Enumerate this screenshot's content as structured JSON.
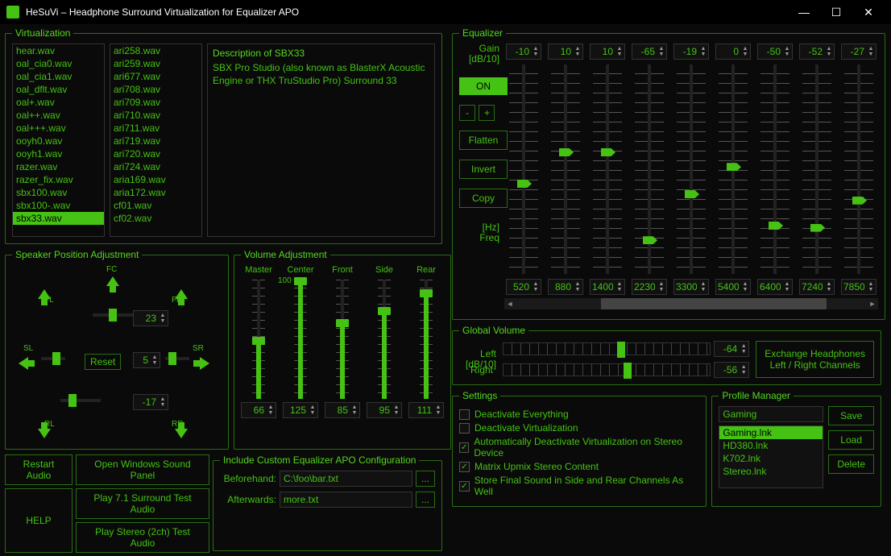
{
  "window": {
    "title": "HeSuVi – Headphone Surround Virtualization for Equalizer APO",
    "min": "—",
    "max": "☐",
    "close": "✕"
  },
  "virtualization": {
    "legend": "Virtualization",
    "list1": [
      "hear.wav",
      "oal_cia0.wav",
      "oal_cia1.wav",
      "oal_dflt.wav",
      "oal+.wav",
      "oal++.wav",
      "oal+++.wav",
      "ooyh0.wav",
      "ooyh1.wav",
      "razer.wav",
      "razer_fix.wav",
      "sbx100.wav",
      "sbx100-.wav",
      "sbx33.wav"
    ],
    "list1_selected": "sbx33.wav",
    "list2": [
      "ari258.wav",
      "ari259.wav",
      "ari677.wav",
      "ari708.wav",
      "ari709.wav",
      "ari710.wav",
      "ari711.wav",
      "ari719.wav",
      "ari720.wav",
      "ari724.wav",
      "aria169.wav",
      "aria172.wav",
      "cf01.wav",
      "cf02.wav"
    ],
    "desc_title": "Description of SBX33",
    "desc_text": "SBX Pro Studio (also known as BlasterX Acoustic Engine or THX TruStudio Pro) Surround 33"
  },
  "speakers": {
    "legend": "Speaker Position Adjustment",
    "labels": {
      "fl": "FL",
      "fc": "FC",
      "fr": "FR",
      "sl": "SL",
      "sr": "SR",
      "rl": "RL",
      "rr": "RR"
    },
    "top_val": "23",
    "mid_val": "5",
    "bot_val": "-17",
    "reset": "Reset"
  },
  "volume": {
    "legend": "Volume Adjustment",
    "cols": [
      {
        "name": "Master",
        "val": "66",
        "fill": 45
      },
      {
        "name": "Center",
        "val": "125",
        "fill": 95
      },
      {
        "name": "Front",
        "val": "85",
        "fill": 60
      },
      {
        "name": "Side",
        "val": "95",
        "fill": 70
      },
      {
        "name": "Rear",
        "val": "111",
        "fill": 85
      }
    ],
    "bubble": "100"
  },
  "bottom": {
    "restart": "Restart Audio",
    "open_panel": "Open Windows Sound Panel",
    "help": "HELP",
    "play71": "Play 7.1 Surround Test Audio",
    "play2": "Play Stereo (2ch) Test Audio"
  },
  "include_cfg": {
    "legend": "Include Custom Equalizer APO Configuration",
    "before_lbl": "Beforehand:",
    "before_val": "C:\\foo\\bar.txt",
    "after_lbl": "Afterwards:",
    "after_val": "more.txt",
    "browse": "..."
  },
  "equalizer": {
    "legend": "Equalizer",
    "gain_lbl": "Gain\n[dB/10]",
    "freq_lbl": "[Hz]\nFreq",
    "bands": [
      {
        "gain": "-10",
        "freq": "520",
        "pos": 55
      },
      {
        "gain": "10",
        "freq": "880",
        "pos": 40
      },
      {
        "gain": "10",
        "freq": "1400",
        "pos": 40
      },
      {
        "gain": "-65",
        "freq": "2230",
        "pos": 82
      },
      {
        "gain": "-19",
        "freq": "3300",
        "pos": 60
      },
      {
        "gain": "0",
        "freq": "5400",
        "pos": 47
      },
      {
        "gain": "-50",
        "freq": "6400",
        "pos": 75
      },
      {
        "gain": "-52",
        "freq": "7240",
        "pos": 76
      },
      {
        "gain": "-27",
        "freq": "7850",
        "pos": 63
      }
    ],
    "on": "ON",
    "minus": "-",
    "plus": "+",
    "flatten": "Flatten",
    "invert": "Invert",
    "copy": "Copy"
  },
  "global_vol": {
    "legend": "Global Volume",
    "left_lbl": "Left\n[dB/10]",
    "right_lbl": "Right",
    "left_val": "-64",
    "right_val": "-56",
    "exchange": "Exchange Headphones\nLeft / Right Channels"
  },
  "settings": {
    "legend": "Settings",
    "items": [
      {
        "label": "Deactivate Everything",
        "checked": false
      },
      {
        "label": "Deactivate Virtualization",
        "checked": false
      },
      {
        "label": "Automatically Deactivate Virtualization on Stereo Device",
        "checked": true
      },
      {
        "label": "Matrix Upmix Stereo Content",
        "checked": true
      },
      {
        "label": "Store Final Sound in Side and Rear Channels As Well",
        "checked": true
      }
    ]
  },
  "profiles": {
    "legend": "Profile Manager",
    "current": "Gaming",
    "list": [
      "Gaming.lnk",
      "HD380.lnk",
      "K702.lnk",
      "Stereo.lnk"
    ],
    "selected": "Gaming.lnk",
    "save": "Save",
    "load": "Load",
    "delete": "Delete"
  }
}
